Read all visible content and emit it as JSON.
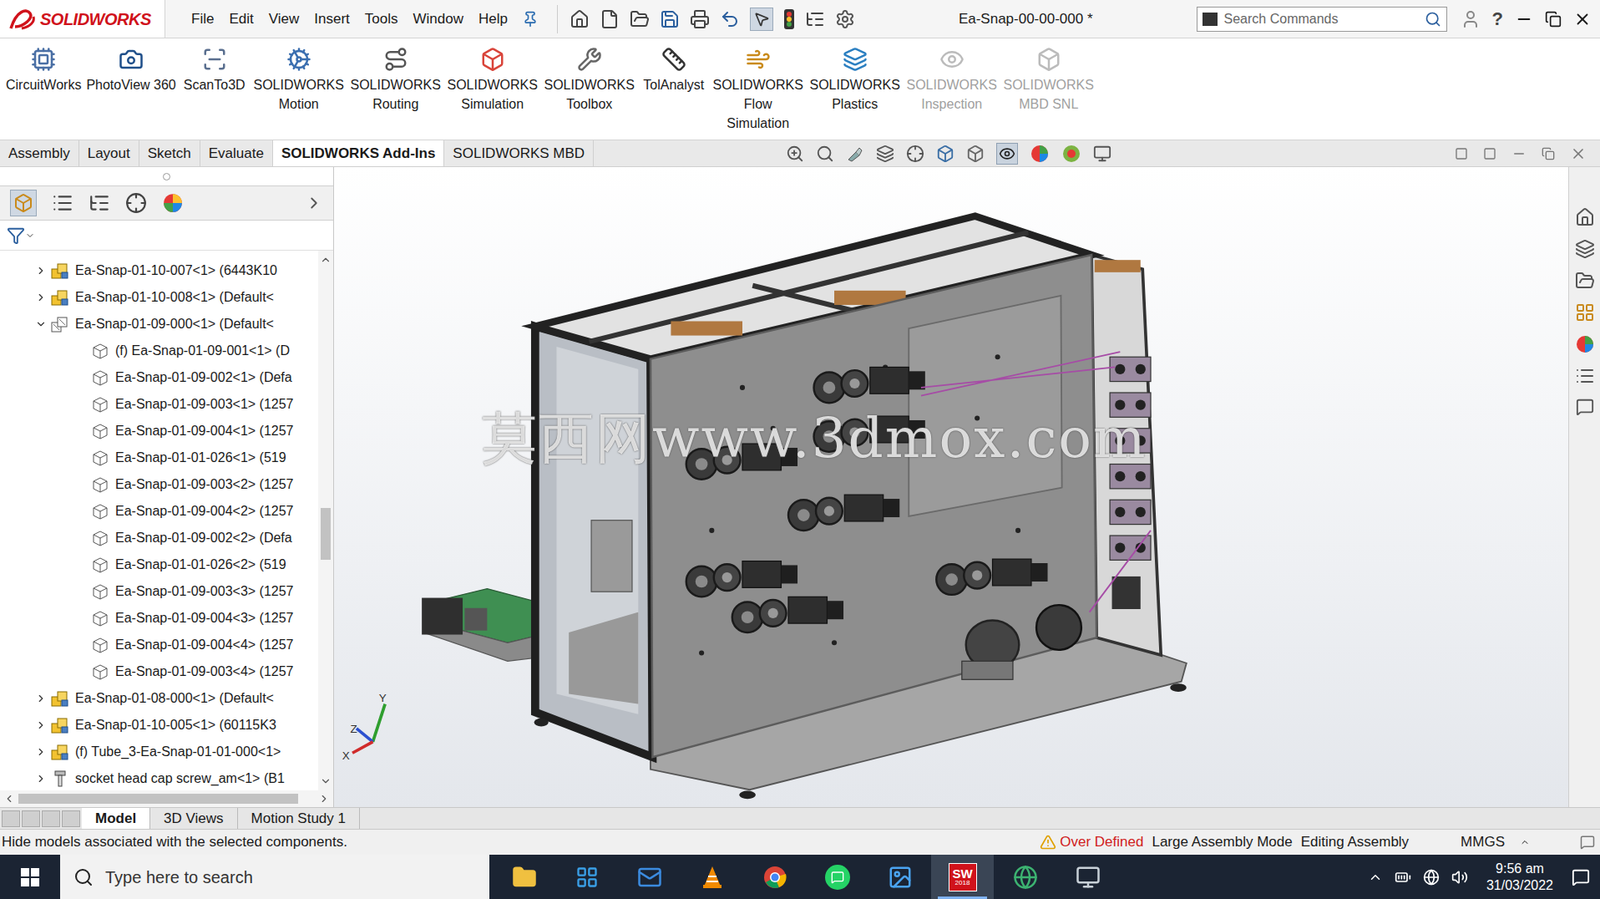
{
  "window": {
    "logo": "SOLIDWORKS",
    "title": "Ea-Snap-00-00-000 *",
    "help": "?"
  },
  "menu": [
    "File",
    "Edit",
    "View",
    "Insert",
    "Tools",
    "Window",
    "Help"
  ],
  "search": {
    "placeholder": "Search Commands"
  },
  "ribbon": [
    {
      "label": "CircuitWorks",
      "disabled": false
    },
    {
      "label": "PhotoView 360",
      "disabled": false
    },
    {
      "label": "ScanTo3D",
      "disabled": false
    },
    {
      "label": "SOLIDWORKS Motion",
      "disabled": false
    },
    {
      "label": "SOLIDWORKS Routing",
      "disabled": false
    },
    {
      "label": "SOLIDWORKS Simulation",
      "disabled": false
    },
    {
      "label": "SOLIDWORKS Toolbox",
      "disabled": false
    },
    {
      "label": "TolAnalyst",
      "disabled": false
    },
    {
      "label": "SOLIDWORKS Flow Simulation",
      "disabled": false
    },
    {
      "label": "SOLIDWORKS Plastics",
      "disabled": false
    },
    {
      "label": "SOLIDWORKS Inspection",
      "disabled": true
    },
    {
      "label": "SOLIDWORKS MBD SNL",
      "disabled": true
    }
  ],
  "tabs": [
    {
      "label": "Assembly",
      "selected": false
    },
    {
      "label": "Layout",
      "selected": false
    },
    {
      "label": "Sketch",
      "selected": false
    },
    {
      "label": "Evaluate",
      "selected": false
    },
    {
      "label": "SOLIDWORKS Add-Ins",
      "selected": true
    },
    {
      "label": "SOLIDWORKS MBD",
      "selected": false
    }
  ],
  "tree": [
    {
      "name": "Ea-Snap-01-10-007<1> (6443K10",
      "level": 1,
      "kind": "assembly",
      "expanded": false
    },
    {
      "name": "Ea-Snap-01-10-008<1> (Default<",
      "level": 1,
      "kind": "assembly",
      "expanded": false
    },
    {
      "name": "Ea-Snap-01-09-000<1> (Default<",
      "level": 1,
      "kind": "assembly-open",
      "expanded": true
    },
    {
      "name": "(f) Ea-Snap-01-09-001<1> (D",
      "level": 2,
      "kind": "part",
      "expanded": false
    },
    {
      "name": "Ea-Snap-01-09-002<1> (Defa",
      "level": 2,
      "kind": "part",
      "expanded": false
    },
    {
      "name": "Ea-Snap-01-09-003<1> (1257",
      "level": 2,
      "kind": "part",
      "expanded": false
    },
    {
      "name": "Ea-Snap-01-09-004<1> (1257",
      "level": 2,
      "kind": "part",
      "expanded": false
    },
    {
      "name": "Ea-Snap-01-01-026<1> (519",
      "level": 2,
      "kind": "part",
      "expanded": false
    },
    {
      "name": "Ea-Snap-01-09-003<2> (1257",
      "level": 2,
      "kind": "part",
      "expanded": false
    },
    {
      "name": "Ea-Snap-01-09-004<2> (1257",
      "level": 2,
      "kind": "part",
      "expanded": false
    },
    {
      "name": "Ea-Snap-01-09-002<2> (Defa",
      "level": 2,
      "kind": "part",
      "expanded": false
    },
    {
      "name": "Ea-Snap-01-01-026<2> (519",
      "level": 2,
      "kind": "part",
      "expanded": false
    },
    {
      "name": "Ea-Snap-01-09-003<3> (1257",
      "level": 2,
      "kind": "part",
      "expanded": false
    },
    {
      "name": "Ea-Snap-01-09-004<3> (1257",
      "level": 2,
      "kind": "part",
      "expanded": false
    },
    {
      "name": "Ea-Snap-01-09-004<4> (1257",
      "level": 2,
      "kind": "part",
      "expanded": false
    },
    {
      "name": "Ea-Snap-01-09-003<4> (1257",
      "level": 2,
      "kind": "part",
      "expanded": false
    },
    {
      "name": "Ea-Snap-01-08-000<1> (Default<",
      "level": 1,
      "kind": "assembly",
      "expanded": false
    },
    {
      "name": "Ea-Snap-01-10-005<1> (60115K3",
      "level": 1,
      "kind": "assembly",
      "expanded": false
    },
    {
      "name": "(f) Tube_3-Ea-Snap-01-01-000<1>",
      "level": 1,
      "kind": "assembly",
      "expanded": false
    },
    {
      "name": "socket head cap screw_am<1> (B1",
      "level": 1,
      "kind": "screw",
      "expanded": false
    }
  ],
  "graphics": {
    "watermark": "莫西网www.3dmox.com",
    "triad": [
      "Y",
      "Z",
      "X"
    ]
  },
  "bottom_tabs": [
    {
      "label": "Model",
      "selected": true
    },
    {
      "label": "3D Views",
      "selected": false
    },
    {
      "label": "Motion Study 1",
      "selected": false
    }
  ],
  "status_bar": {
    "message": "Hide models associated with the selected components.",
    "warning": "Over Defined",
    "mode": "Large Assembly Mode",
    "state": "Editing Assembly",
    "units": "MMGS"
  },
  "taskbar": {
    "search_placeholder": "Type here to search",
    "apps": [
      {
        "kind": "explorer",
        "active": false
      },
      {
        "kind": "store",
        "active": false
      },
      {
        "kind": "mail",
        "active": false
      },
      {
        "kind": "vlc",
        "active": false
      },
      {
        "kind": "chrome",
        "active": false
      },
      {
        "kind": "whatsapp",
        "active": false
      },
      {
        "kind": "photos",
        "active": false
      },
      {
        "kind": "solidworks",
        "label": "SW",
        "sub": "2018",
        "active": true
      },
      {
        "kind": "globe",
        "active": false
      },
      {
        "kind": "monitor",
        "active": false
      }
    ],
    "time": "9:56 am",
    "date": "31/03/2022"
  }
}
